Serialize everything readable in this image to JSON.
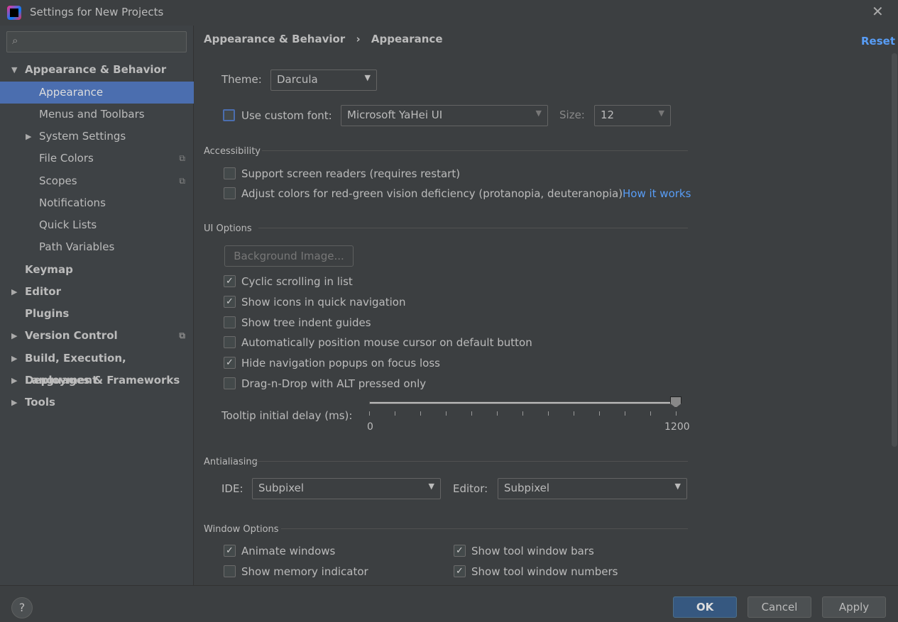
{
  "window": {
    "title": "Settings for New Projects",
    "close": "✕"
  },
  "sidebar": {
    "search_placeholder": "",
    "items": [
      {
        "label": "Appearance & Behavior",
        "expanded": true,
        "bold": true
      },
      {
        "label": "Appearance",
        "selected": true
      },
      {
        "label": "Menus and Toolbars"
      },
      {
        "label": "System Settings",
        "expandable": true
      },
      {
        "label": "File Colors",
        "icon": "copy-icon"
      },
      {
        "label": "Scopes",
        "icon": "copy-icon"
      },
      {
        "label": "Notifications"
      },
      {
        "label": "Quick Lists"
      },
      {
        "label": "Path Variables"
      },
      {
        "label": "Keymap",
        "bold": true
      },
      {
        "label": "Editor",
        "bold": true,
        "expandable": true
      },
      {
        "label": "Plugins",
        "bold": true
      },
      {
        "label": "Version Control",
        "bold": true,
        "expandable": true,
        "icon": "copy-icon"
      },
      {
        "label": "Build, Execution, Deployment",
        "bold": true,
        "expandable": true
      },
      {
        "label": "Languages & Frameworks",
        "bold": true,
        "expandable": true
      },
      {
        "label": "Tools",
        "bold": true,
        "expandable": true
      }
    ]
  },
  "breadcrumb": {
    "parent": "Appearance & Behavior",
    "sep": "›",
    "current": "Appearance"
  },
  "reset": "Reset",
  "theme": {
    "label": "Theme:",
    "value": "Darcula"
  },
  "font": {
    "label": "Use custom font:",
    "checked": false,
    "value": "Microsoft YaHei UI",
    "size_label": "Size:",
    "size": "12"
  },
  "accessibility": {
    "title": "Accessibility",
    "screen_readers": "Support screen readers (requires restart)",
    "color_adjust": "Adjust colors for red-green vision deficiency (protanopia, deuteranopia)",
    "how_it_works": "How it works"
  },
  "ui_options": {
    "title": "UI Options",
    "background_image": "Background Image...",
    "options": [
      {
        "label": "Cyclic scrolling in list",
        "checked": true
      },
      {
        "label": "Show icons in quick navigation",
        "checked": true
      },
      {
        "label": "Show tree indent guides",
        "checked": false
      },
      {
        "label": "Automatically position mouse cursor on default button",
        "checked": false
      },
      {
        "label": "Hide navigation popups on focus loss",
        "checked": true
      },
      {
        "label": "Drag-n-Drop with ALT pressed only",
        "checked": false
      }
    ],
    "tooltip": {
      "label": "Tooltip initial delay (ms):",
      "min": "0",
      "max": "1200",
      "value": 1200
    }
  },
  "antialiasing": {
    "title": "Antialiasing",
    "ide_label": "IDE:",
    "ide": "Subpixel",
    "editor_label": "Editor:",
    "editor": "Subpixel"
  },
  "window_options": {
    "title": "Window Options",
    "options": [
      {
        "label": "Animate windows",
        "checked": true
      },
      {
        "label": "Show tool window bars",
        "checked": true
      },
      {
        "label": "Show memory indicator",
        "checked": false
      },
      {
        "label": "Show tool window numbers",
        "checked": true
      }
    ]
  },
  "footer": {
    "help": "?",
    "ok": "OK",
    "cancel": "Cancel",
    "apply": "Apply"
  },
  "colors": {
    "accent": "#4b6eaf",
    "link": "#589df6",
    "background": "#3c3f41"
  }
}
